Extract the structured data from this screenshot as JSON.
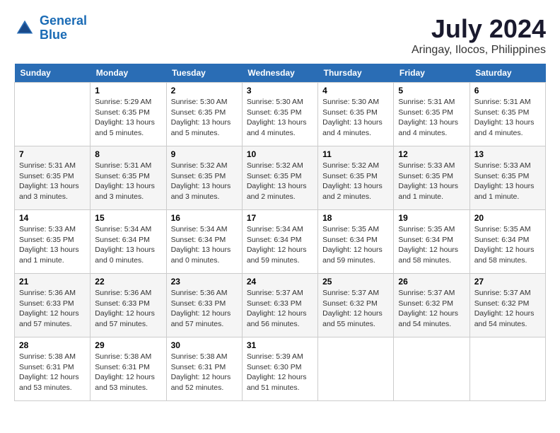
{
  "header": {
    "logo_line1": "General",
    "logo_line2": "Blue",
    "month_year": "July 2024",
    "location": "Aringay, Ilocos, Philippines"
  },
  "weekdays": [
    "Sunday",
    "Monday",
    "Tuesday",
    "Wednesday",
    "Thursday",
    "Friday",
    "Saturday"
  ],
  "weeks": [
    [
      {
        "day": "",
        "info": ""
      },
      {
        "day": "1",
        "info": "Sunrise: 5:29 AM\nSunset: 6:35 PM\nDaylight: 13 hours\nand 5 minutes."
      },
      {
        "day": "2",
        "info": "Sunrise: 5:30 AM\nSunset: 6:35 PM\nDaylight: 13 hours\nand 5 minutes."
      },
      {
        "day": "3",
        "info": "Sunrise: 5:30 AM\nSunset: 6:35 PM\nDaylight: 13 hours\nand 4 minutes."
      },
      {
        "day": "4",
        "info": "Sunrise: 5:30 AM\nSunset: 6:35 PM\nDaylight: 13 hours\nand 4 minutes."
      },
      {
        "day": "5",
        "info": "Sunrise: 5:31 AM\nSunset: 6:35 PM\nDaylight: 13 hours\nand 4 minutes."
      },
      {
        "day": "6",
        "info": "Sunrise: 5:31 AM\nSunset: 6:35 PM\nDaylight: 13 hours\nand 4 minutes."
      }
    ],
    [
      {
        "day": "7",
        "info": "Sunrise: 5:31 AM\nSunset: 6:35 PM\nDaylight: 13 hours\nand 3 minutes."
      },
      {
        "day": "8",
        "info": "Sunrise: 5:31 AM\nSunset: 6:35 PM\nDaylight: 13 hours\nand 3 minutes."
      },
      {
        "day": "9",
        "info": "Sunrise: 5:32 AM\nSunset: 6:35 PM\nDaylight: 13 hours\nand 3 minutes."
      },
      {
        "day": "10",
        "info": "Sunrise: 5:32 AM\nSunset: 6:35 PM\nDaylight: 13 hours\nand 2 minutes."
      },
      {
        "day": "11",
        "info": "Sunrise: 5:32 AM\nSunset: 6:35 PM\nDaylight: 13 hours\nand 2 minutes."
      },
      {
        "day": "12",
        "info": "Sunrise: 5:33 AM\nSunset: 6:35 PM\nDaylight: 13 hours\nand 1 minute."
      },
      {
        "day": "13",
        "info": "Sunrise: 5:33 AM\nSunset: 6:35 PM\nDaylight: 13 hours\nand 1 minute."
      }
    ],
    [
      {
        "day": "14",
        "info": "Sunrise: 5:33 AM\nSunset: 6:35 PM\nDaylight: 13 hours\nand 1 minute."
      },
      {
        "day": "15",
        "info": "Sunrise: 5:34 AM\nSunset: 6:34 PM\nDaylight: 13 hours\nand 0 minutes."
      },
      {
        "day": "16",
        "info": "Sunrise: 5:34 AM\nSunset: 6:34 PM\nDaylight: 13 hours\nand 0 minutes."
      },
      {
        "day": "17",
        "info": "Sunrise: 5:34 AM\nSunset: 6:34 PM\nDaylight: 12 hours\nand 59 minutes."
      },
      {
        "day": "18",
        "info": "Sunrise: 5:35 AM\nSunset: 6:34 PM\nDaylight: 12 hours\nand 59 minutes."
      },
      {
        "day": "19",
        "info": "Sunrise: 5:35 AM\nSunset: 6:34 PM\nDaylight: 12 hours\nand 58 minutes."
      },
      {
        "day": "20",
        "info": "Sunrise: 5:35 AM\nSunset: 6:34 PM\nDaylight: 12 hours\nand 58 minutes."
      }
    ],
    [
      {
        "day": "21",
        "info": "Sunrise: 5:36 AM\nSunset: 6:33 PM\nDaylight: 12 hours\nand 57 minutes."
      },
      {
        "day": "22",
        "info": "Sunrise: 5:36 AM\nSunset: 6:33 PM\nDaylight: 12 hours\nand 57 minutes."
      },
      {
        "day": "23",
        "info": "Sunrise: 5:36 AM\nSunset: 6:33 PM\nDaylight: 12 hours\nand 57 minutes."
      },
      {
        "day": "24",
        "info": "Sunrise: 5:37 AM\nSunset: 6:33 PM\nDaylight: 12 hours\nand 56 minutes."
      },
      {
        "day": "25",
        "info": "Sunrise: 5:37 AM\nSunset: 6:32 PM\nDaylight: 12 hours\nand 55 minutes."
      },
      {
        "day": "26",
        "info": "Sunrise: 5:37 AM\nSunset: 6:32 PM\nDaylight: 12 hours\nand 54 minutes."
      },
      {
        "day": "27",
        "info": "Sunrise: 5:37 AM\nSunset: 6:32 PM\nDaylight: 12 hours\nand 54 minutes."
      }
    ],
    [
      {
        "day": "28",
        "info": "Sunrise: 5:38 AM\nSunset: 6:31 PM\nDaylight: 12 hours\nand 53 minutes."
      },
      {
        "day": "29",
        "info": "Sunrise: 5:38 AM\nSunset: 6:31 PM\nDaylight: 12 hours\nand 53 minutes."
      },
      {
        "day": "30",
        "info": "Sunrise: 5:38 AM\nSunset: 6:31 PM\nDaylight: 12 hours\nand 52 minutes."
      },
      {
        "day": "31",
        "info": "Sunrise: 5:39 AM\nSunset: 6:30 PM\nDaylight: 12 hours\nand 51 minutes."
      },
      {
        "day": "",
        "info": ""
      },
      {
        "day": "",
        "info": ""
      },
      {
        "day": "",
        "info": ""
      }
    ]
  ]
}
